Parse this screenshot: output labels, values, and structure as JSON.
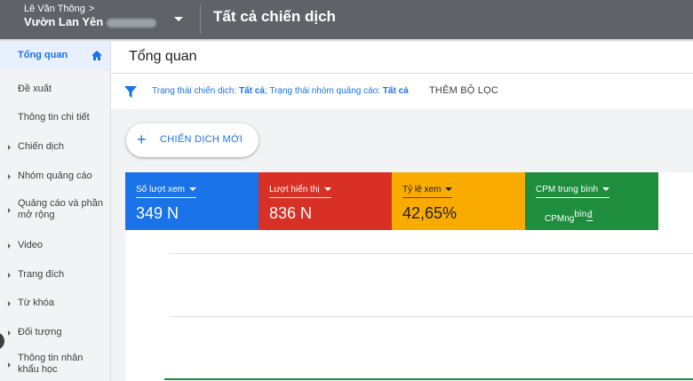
{
  "header": {
    "account_name": "Lê Văn Thông",
    "account_sub": "Vườn Lan Yên",
    "page_title": "Tất cả chiến dịch"
  },
  "sidebar": {
    "items": [
      {
        "label": "Tổng quan",
        "active": true
      },
      {
        "label": "Đề xuất"
      },
      {
        "label": "Thông tin chi tiết"
      },
      {
        "label": "Chiến dịch"
      },
      {
        "label": "Nhóm quảng cáo"
      },
      {
        "label": "Quảng cáo và phần mở rộng"
      },
      {
        "label": "Video"
      },
      {
        "label": "Trang đích"
      },
      {
        "label": "Từ khóa"
      },
      {
        "label": "Đối tượng"
      },
      {
        "label": "Thông tin nhân khẩu học"
      }
    ]
  },
  "main": {
    "title": "Tổng quan",
    "filter": {
      "label1": "Trạng thái chiến dịch: ",
      "value1": "Tất cả",
      "sep": "; ",
      "label2": "Trạng thái nhóm quảng cáo: ",
      "value2": "Tất cả",
      "add_filter": "THÊM BỘ LỌC"
    },
    "new_campaign": "CHIẾN DỊCH MỚI",
    "metrics": [
      {
        "label": "Số lượt xem",
        "value": "349 N",
        "color": "#1a73e8"
      },
      {
        "label": "Lượt hiển thị",
        "value": "836 N",
        "color": "#d93025"
      },
      {
        "label": "Tỷ lệ xem",
        "value": "42,65%",
        "color": "#f9ab00"
      },
      {
        "label": "CPM trung bình",
        "value_main": "CPMng",
        "value_sup": "bìn",
        "value_currency": "₫",
        "color": "#1e8e3e"
      }
    ]
  },
  "icons": {
    "home": "home-icon",
    "filter": "filter-icon",
    "plus": "plus-icon",
    "dropdown": "caret-down-icon"
  }
}
